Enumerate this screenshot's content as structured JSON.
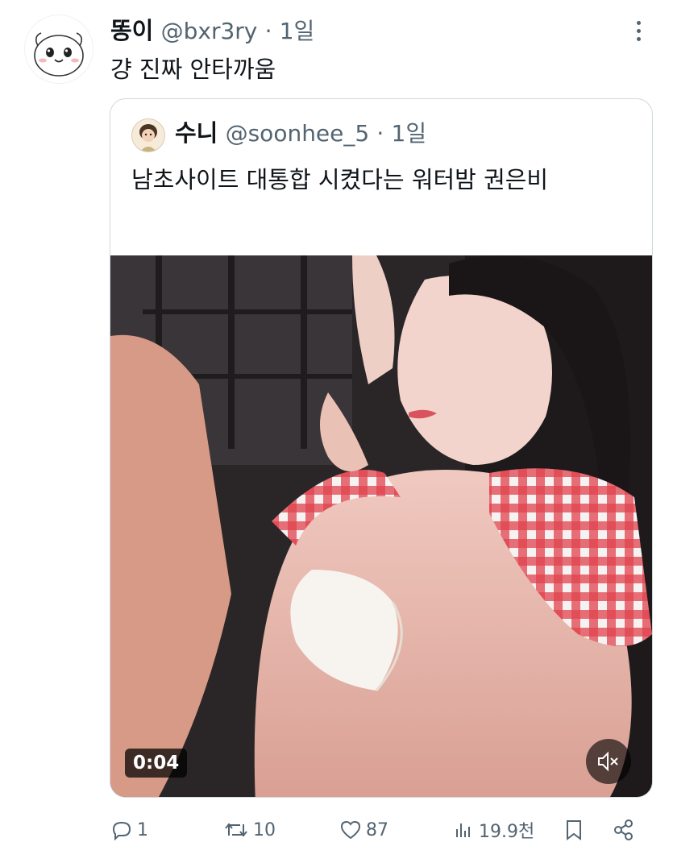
{
  "tweet": {
    "author_name": "똥이",
    "author_handle": "@bxr3ry",
    "separator": "·",
    "time": "1일",
    "text": "걍 진짜 안타까움"
  },
  "quoted": {
    "author_name": "수니",
    "author_handle": "@soonhee_5",
    "separator": "·",
    "time": "1일",
    "text": "남초사이트 대통합 시켰다는 워터밤 권은비",
    "video_duration": "0:04"
  },
  "actions": {
    "replies": "1",
    "reposts": "10",
    "likes": "87",
    "views": "19.9천"
  },
  "icons": {
    "more": "more-vertical-icon",
    "mute": "volume-muted-icon",
    "reply": "reply-icon",
    "repost": "repost-icon",
    "like": "heart-icon",
    "views": "views-chart-icon",
    "bookmark": "bookmark-icon",
    "share": "share-icon"
  },
  "colors": {
    "text_primary": "#0f1419",
    "text_secondary": "#536471",
    "border": "#cfd9de"
  }
}
